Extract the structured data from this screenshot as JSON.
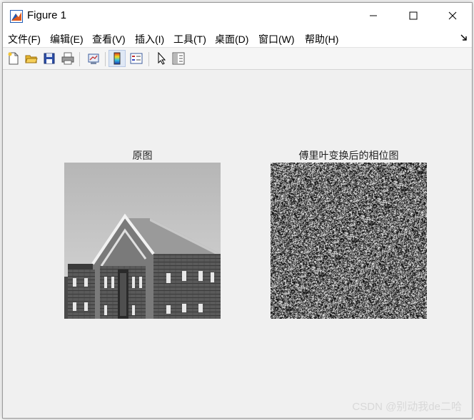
{
  "window": {
    "title": "Figure 1",
    "controls": {
      "minimize": "minimize-icon",
      "maximize": "maximize-icon",
      "close": "close-icon"
    }
  },
  "menubar": {
    "items": [
      "文件(F)",
      "编辑(E)",
      "查看(V)",
      "插入(I)",
      "工具(T)",
      "桌面(D)",
      "窗口(W)",
      "帮助(H)"
    ]
  },
  "toolbar": {
    "buttons": [
      "new-figure-icon",
      "open-file-icon",
      "save-icon",
      "print-icon",
      "link-plot-icon",
      "colorbar-icon",
      "legend-icon",
      "pointer-icon",
      "property-editor-icon"
    ]
  },
  "figure": {
    "left_axes_title": "原图",
    "right_axes_title": "傅里叶变换后的相位图"
  },
  "watermark": "CSDN @别动我de二哈",
  "colors": {
    "titlebar": "#ffffff",
    "canvas": "#f0f0f0",
    "accent": "#1e5ab4"
  }
}
